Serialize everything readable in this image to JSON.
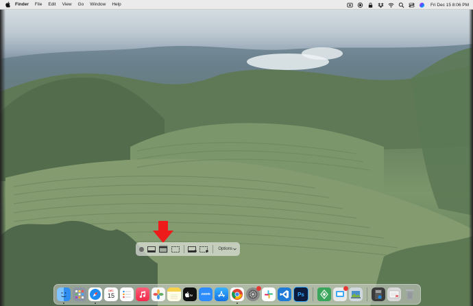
{
  "menubar": {
    "app_name": "Finder",
    "items": [
      "File",
      "Edit",
      "View",
      "Go",
      "Window",
      "Help"
    ],
    "clock": "Fri Dec 15  8:06 PM",
    "status_icons": [
      "screen-record-icon",
      "record-icon",
      "lock-icon",
      "dropbox-icon",
      "wifi-icon",
      "search-icon",
      "control-center-icon",
      "siri-icon"
    ]
  },
  "screenshot_toolbar": {
    "options_label": "Options",
    "modes": [
      "capture-entire-screen",
      "capture-selected-window",
      "capture-selected-portion",
      "record-entire-screen",
      "record-selected-portion"
    ],
    "selected_mode": "capture-selected-window"
  },
  "dock": {
    "apps": [
      {
        "name": "Finder",
        "icon": "finder-icon",
        "color": "#2f8ef0",
        "running": true
      },
      {
        "name": "Launchpad",
        "icon": "launchpad-icon",
        "color": "#8b95a3"
      },
      {
        "name": "Safari",
        "icon": "safari-icon",
        "color": "#1d8bf1",
        "running": true
      },
      {
        "name": "Calendar",
        "icon": "calendar-icon",
        "color": "#ffffff",
        "label": "15"
      },
      {
        "name": "Reminders",
        "icon": "reminders-icon",
        "color": "#ffffff"
      },
      {
        "name": "Music",
        "icon": "music-icon",
        "color": "#f5415a"
      },
      {
        "name": "Photos",
        "icon": "photos-icon",
        "color": "#f7f7f7"
      },
      {
        "name": "Notes",
        "icon": "notes-icon",
        "color": "#f7d24c"
      },
      {
        "name": "Apple TV",
        "icon": "tv-icon",
        "color": "#111111"
      },
      {
        "name": "Zoom",
        "icon": "zoom-icon",
        "color": "#2d8cff",
        "label": "zoom"
      },
      {
        "name": "App Store",
        "icon": "app-store-icon",
        "color": "#1c8df7"
      },
      {
        "name": "Chrome",
        "icon": "chrome-icon",
        "color": "#ffffff",
        "running": true
      },
      {
        "name": "System Settings",
        "icon": "settings-icon",
        "color": "#8a8a8a",
        "badge": true
      },
      {
        "name": "Slack",
        "icon": "slack-icon",
        "color": "#ffffff"
      },
      {
        "name": "VS Code",
        "icon": "vscode-icon",
        "color": "#1f7bd6"
      },
      {
        "name": "Photoshop",
        "icon": "photoshop-icon",
        "color": "#0d1b3c",
        "label": "Ps"
      },
      {
        "name": "Android File Transfer",
        "icon": "android-icon",
        "color": "#3ba55c"
      },
      {
        "name": "Messages",
        "icon": "messages-icon",
        "color": "#eaeaea",
        "badge": true
      },
      {
        "name": "Preview",
        "icon": "preview-icon",
        "color": "#4a90c8"
      }
    ],
    "stacks": [
      {
        "name": "Downloads",
        "icon": "downloads-stack-icon",
        "color": "#3a3a3a"
      },
      {
        "name": "Documents",
        "icon": "documents-stack-icon",
        "color": "#d8d8d8"
      },
      {
        "name": "Trash",
        "icon": "trash-icon",
        "color": "#9ea3a6"
      }
    ]
  }
}
